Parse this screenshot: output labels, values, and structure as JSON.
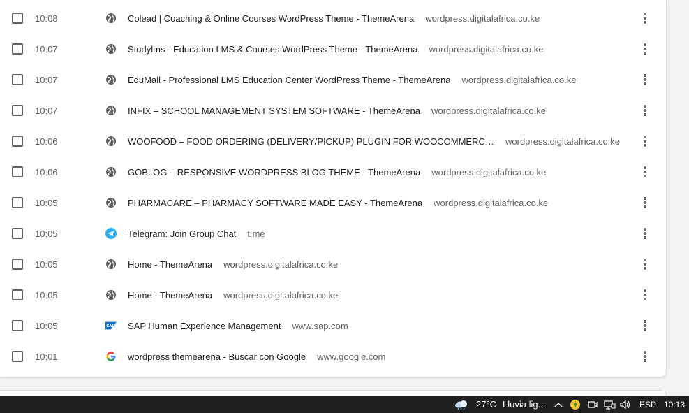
{
  "history": {
    "rows": [
      {
        "time": "10:08",
        "title": "Colead | Coaching & Online Courses WordPress Theme - ThemeArena",
        "domain": "wordpress.digitalafrica.co.ke",
        "icon": "globe-icon"
      },
      {
        "time": "10:07",
        "title": "Studylms - Education LMS & Courses WordPress Theme - ThemeArena",
        "domain": "wordpress.digitalafrica.co.ke",
        "icon": "globe-icon"
      },
      {
        "time": "10:07",
        "title": "EduMall - Professional LMS Education Center WordPress Theme - ThemeArena",
        "domain": "wordpress.digitalafrica.co.ke",
        "icon": "globe-icon"
      },
      {
        "time": "10:07",
        "title": "INFIX – SCHOOL MANAGEMENT SYSTEM SOFTWARE - ThemeArena",
        "domain": "wordpress.digitalafrica.co.ke",
        "icon": "globe-icon"
      },
      {
        "time": "10:06",
        "title": "WOOFOOD – FOOD ORDERING (DELIVERY/PICKUP) PLUGIN FOR WOOCOMMERCE & AUTOMATIC ORDER PRINTING - ThemeArena",
        "domain": "wordpress.digitalafrica.co.ke",
        "icon": "globe-icon"
      },
      {
        "time": "10:06",
        "title": "GOBLOG – RESPONSIVE WORDPRESS BLOG THEME - ThemeArena",
        "domain": "wordpress.digitalafrica.co.ke",
        "icon": "globe-icon"
      },
      {
        "time": "10:05",
        "title": "PHARMACARE – PHARMACY SOFTWARE MADE EASY - ThemeArena",
        "domain": "wordpress.digitalafrica.co.ke",
        "icon": "globe-icon"
      },
      {
        "time": "10:05",
        "title": "Telegram: Join Group Chat",
        "domain": "t.me",
        "icon": "telegram-icon"
      },
      {
        "time": "10:05",
        "title": "Home - ThemeArena",
        "domain": "wordpress.digitalafrica.co.ke",
        "icon": "globe-icon"
      },
      {
        "time": "10:05",
        "title": "Home - ThemeArena",
        "domain": "wordpress.digitalafrica.co.ke",
        "icon": "globe-icon"
      },
      {
        "time": "10:05",
        "title": "SAP Human Experience Management",
        "domain": "www.sap.com",
        "icon": "sap-icon",
        "icon_text": "SAP"
      },
      {
        "time": "10:01",
        "title": "wordpress themearena - Buscar con Google",
        "domain": "www.google.com",
        "icon": "google-icon"
      }
    ]
  },
  "taskbar": {
    "weather_icon": "cloud-rain-icon",
    "temperature": "27°C",
    "weather_text": "Lluvia lig...",
    "language": "ESP",
    "clock": "10:13"
  },
  "colors": {
    "telegram": "#2AABEE",
    "sap": "#0a6ed1",
    "google_blue": "#4285F4",
    "google_red": "#EA4335",
    "google_yellow": "#FBBC05",
    "google_green": "#34A853"
  }
}
